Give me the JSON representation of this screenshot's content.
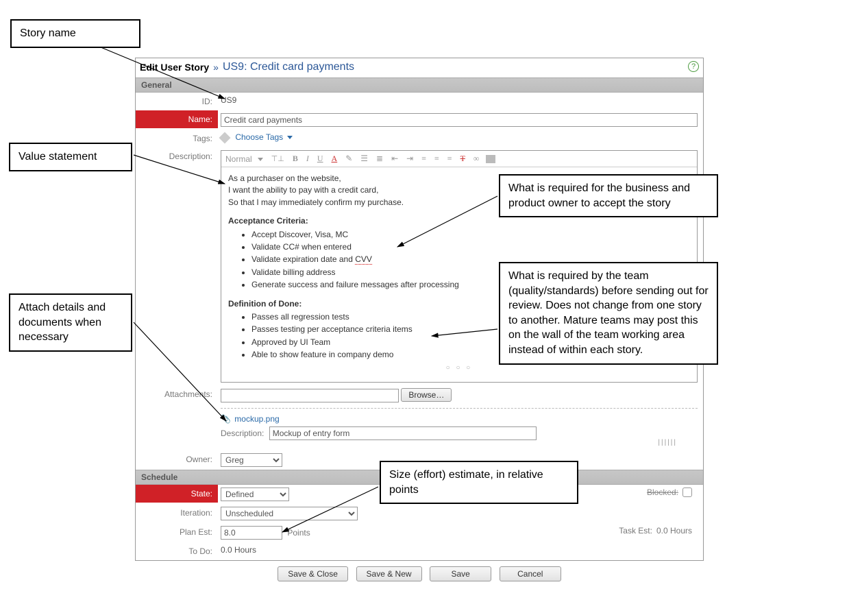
{
  "header": {
    "edit_label": "Edit User Story",
    "separator": "»",
    "title": "US9: Credit card payments"
  },
  "sections": {
    "general": "General",
    "schedule": "Schedule"
  },
  "labels": {
    "id": "ID:",
    "name": "Name:",
    "tags": "Tags:",
    "description": "Description:",
    "attachments": "Attachments:",
    "owner": "Owner:",
    "state": "State:",
    "iteration": "Iteration:",
    "plan_est": "Plan Est:",
    "to_do": "To Do:",
    "task_est": "Task Est:",
    "blocked": "Blocked:",
    "attach_desc": "Description:"
  },
  "values": {
    "id": "US9",
    "name": "Credit card payments",
    "choose_tags": "Choose Tags",
    "editor_style": "Normal",
    "owner": "Greg",
    "state": "Defined",
    "iteration": "Unscheduled",
    "plan_est": "8.0",
    "plan_est_unit": "Points",
    "to_do": "0.0 Hours",
    "task_est": "0.0 Hours",
    "browse": "Browse…",
    "attachment_name": "mockup.png",
    "attachment_desc": "Mockup of entry form"
  },
  "description": {
    "line1": "As a purchaser on the website,",
    "line2": "I want the ability to pay with a credit card,",
    "line3": "So that I may immediately confirm my purchase.",
    "ac_head": "Acceptance Criteria:",
    "ac": [
      "Accept Discover, Visa, MC",
      "Validate CC# when entered",
      "Validate expiration date and CVV",
      "Validate billing address",
      "Generate success and failure messages after processing"
    ],
    "dod_head": "Definition of Done:",
    "dod": [
      "Passes all regression tests",
      "Passes testing per acceptance criteria items",
      "Approved by UI Team",
      "Able to show feature in company demo"
    ]
  },
  "buttons": {
    "save_close": "Save & Close",
    "save_new": "Save & New",
    "save": "Save",
    "cancel": "Cancel"
  },
  "callouts": {
    "story_name": "Story name",
    "value_stmt": "Value statement",
    "attach": "Attach details and documents when necessary",
    "accept": "What is required for the business and product owner to accept the story",
    "dod": "What is required by the team (quality/standards) before sending out for review. Does not change from one story to another. Mature teams may post this on the wall of the team working area instead of within each story.",
    "size": "Size (effort) estimate, in relative points"
  }
}
